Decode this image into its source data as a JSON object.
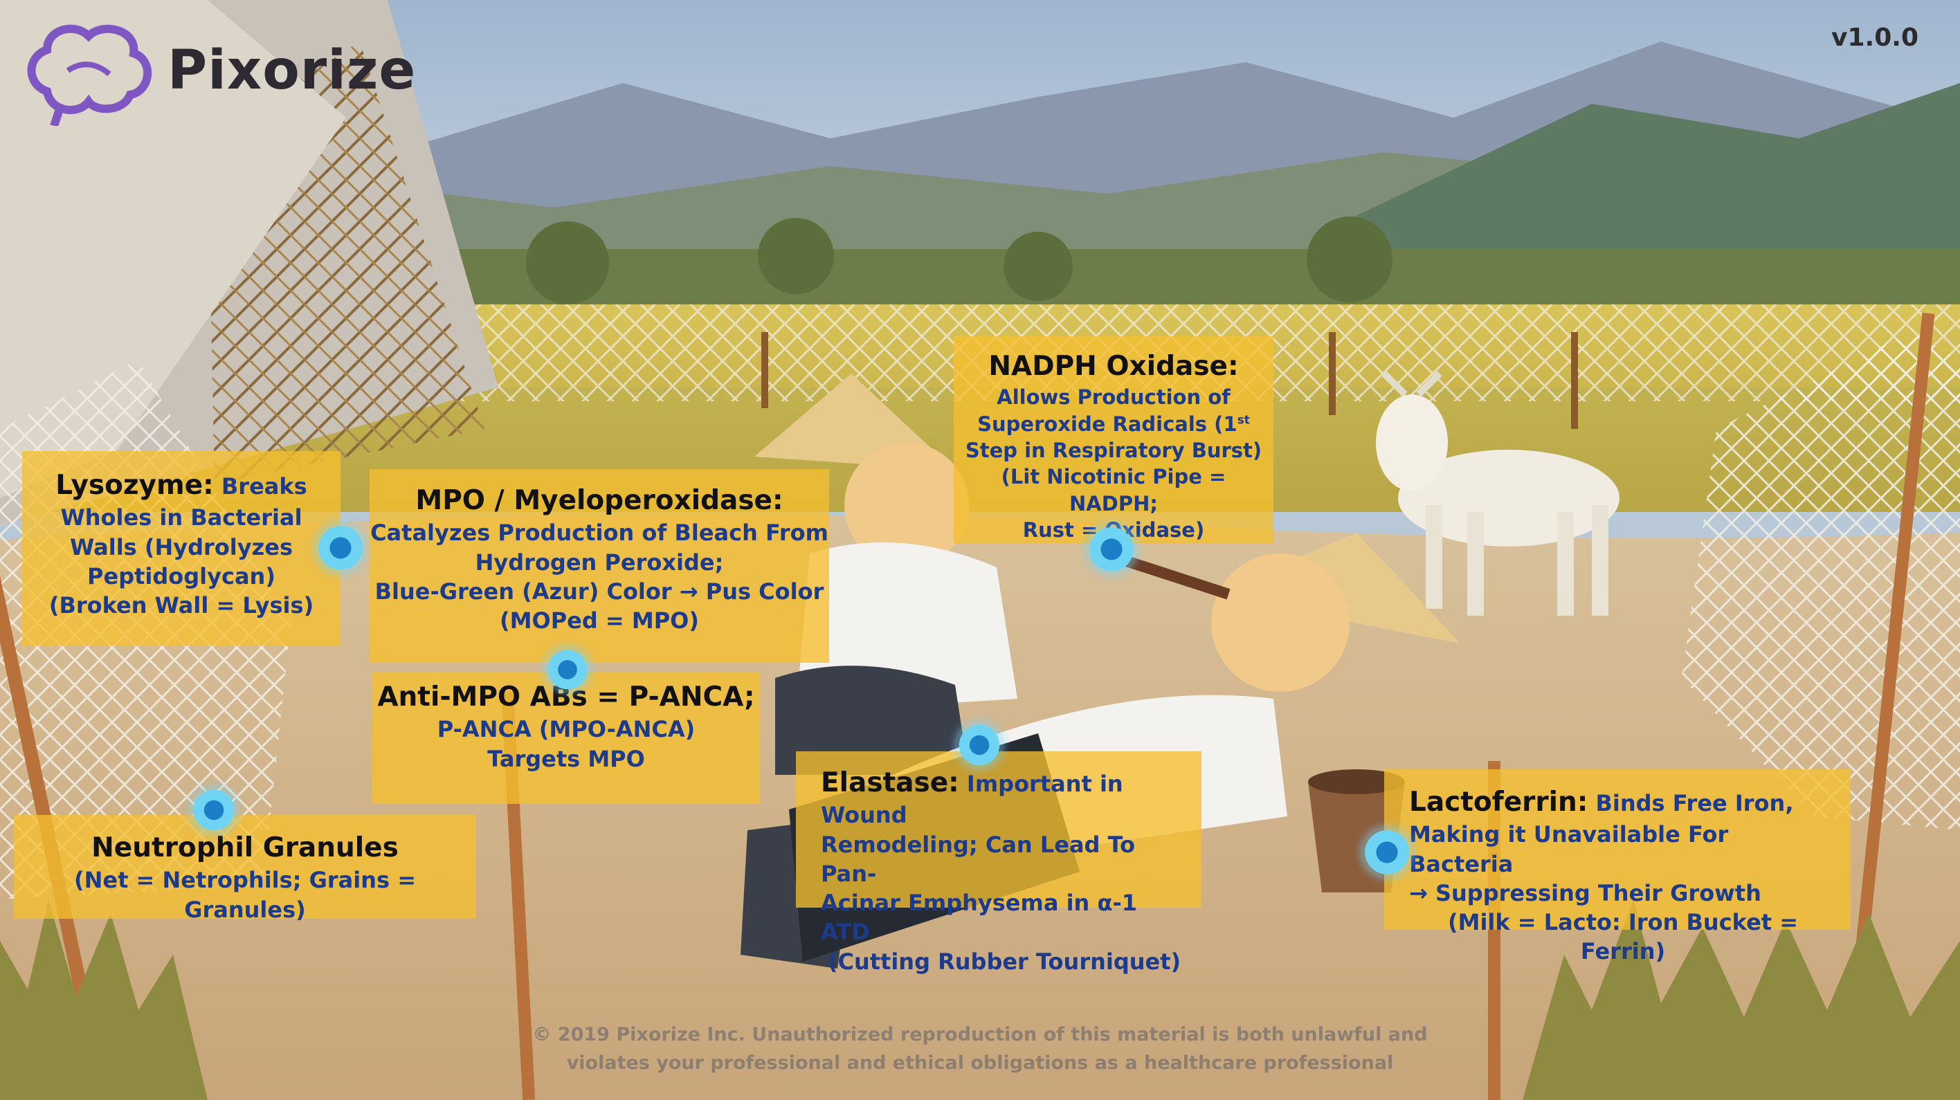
{
  "brand": {
    "name": "Pixorize",
    "logo_icon": "brain-icon",
    "accent": "#7e57c2"
  },
  "version": "v1.0.0",
  "colors": {
    "card_bg": "#f5bf2f",
    "title_text": "#111111",
    "body_text": "#1c3b8c",
    "hotspot": "#4cc3ec"
  },
  "cards": {
    "lysozyme": {
      "title": "Lysozyme:",
      "line1": "Breaks",
      "line2": "Wholes in Bacterial",
      "line3": "Walls (Hydrolyzes",
      "line4": "Peptidoglycan)",
      "line5": "(Broken Wall = Lysis)"
    },
    "mpo": {
      "title": "MPO / Myeloperoxidase:",
      "line1": "Catalyzes Production of Bleach From",
      "line2": "Hydrogen Peroxide;",
      "line3": "Blue-Green (Azur) Color → Pus Color",
      "line4": "(MOPed = MPO)"
    },
    "anti_mpo": {
      "title": "Anti-MPO ABs = P-ANCA;",
      "line1": "P-ANCA (MPO-ANCA)",
      "line2": "Targets MPO"
    },
    "nadph": {
      "title": "NADPH Oxidase:",
      "line1": "Allows Production of",
      "line2a": "Superoxide Radicals (1",
      "line2sup": "st",
      "line3": "Step in Respiratory Burst)",
      "line4": "(Lit Nicotinic Pipe = NADPH;",
      "line5": "Rust = Oxidase)"
    },
    "neutrophil": {
      "title": "Neutrophil Granules",
      "line1": "(Net = Netrophils; Grains = Granules)"
    },
    "elastase": {
      "title": "Elastase:",
      "line1": "Important in Wound",
      "line2": "Remodeling; Can Lead To Pan-",
      "line3": "Acinar Emphysema in α-1 ATD",
      "line4": "(Cutting Rubber Tourniquet)"
    },
    "lactoferrin": {
      "title": "Lactoferrin:",
      "line1": "Binds Free Iron,",
      "line2": "Making it Unavailable For Bacteria",
      "line3": "→ Suppressing Their Growth",
      "line4": "(Milk = Lacto: Iron Bucket = Ferrin)"
    }
  },
  "copyright": {
    "line1": "© 2019 Pixorize Inc. Unauthorized reproduction of this material is both unlawful and",
    "line2": "violates your professional and ethical obligations as a healthcare professional"
  }
}
